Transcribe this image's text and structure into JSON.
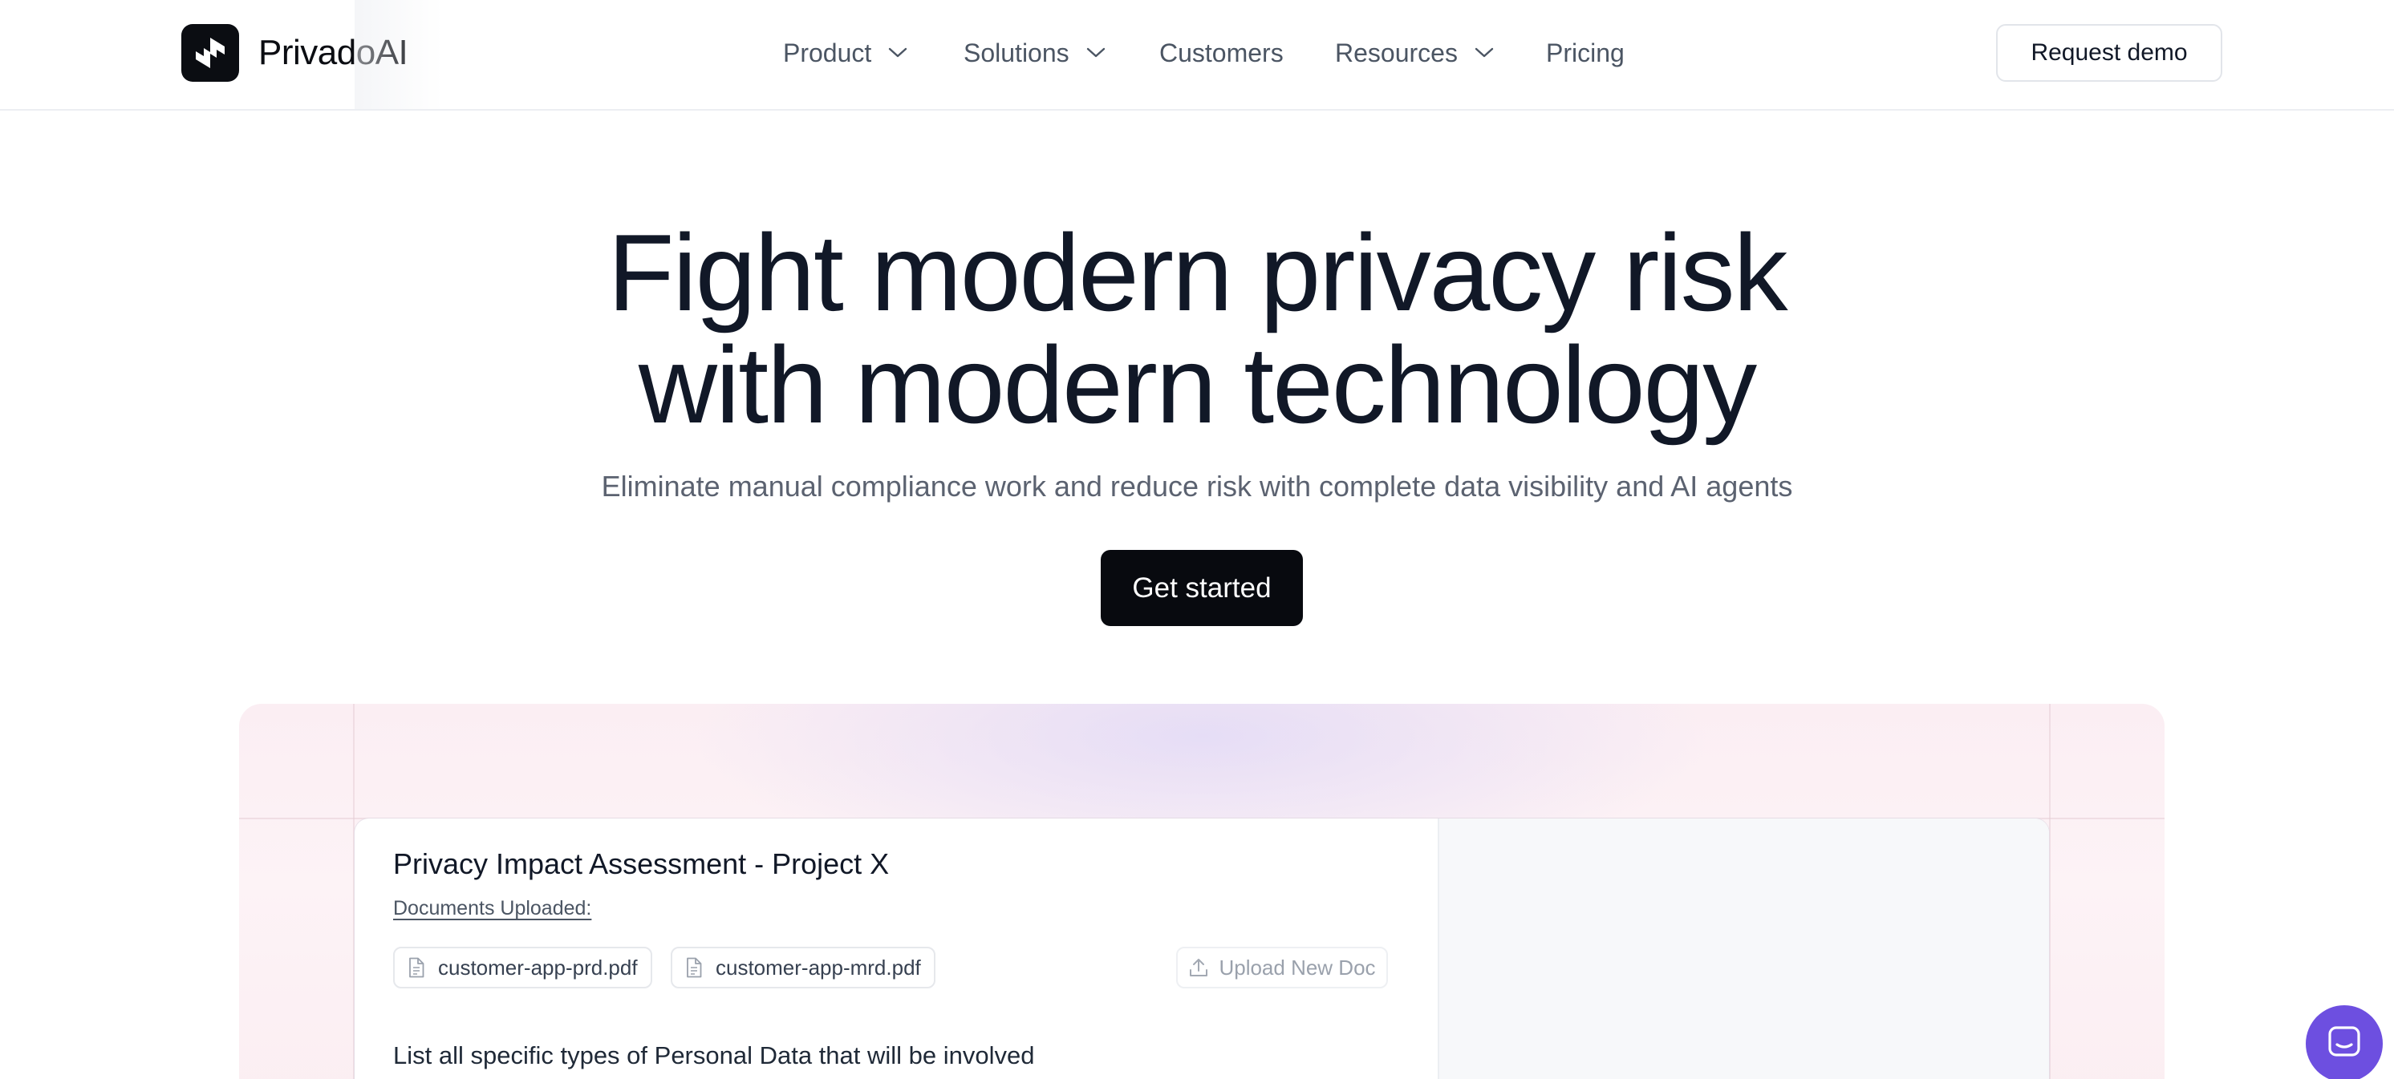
{
  "brand": {
    "name": "PrivadoAI"
  },
  "nav": {
    "items": [
      {
        "label": "Product",
        "has_dropdown": true
      },
      {
        "label": "Solutions",
        "has_dropdown": true
      },
      {
        "label": "Customers",
        "has_dropdown": false
      },
      {
        "label": "Resources",
        "has_dropdown": true
      },
      {
        "label": "Pricing",
        "has_dropdown": false
      }
    ],
    "request_demo_label": "Request demo"
  },
  "hero": {
    "title_line1": "Fight modern privacy risk",
    "title_line2": "with modern technology",
    "subtitle": "Eliminate manual compliance work and reduce risk with complete data visibility and AI agents",
    "cta_label": "Get started"
  },
  "showcase": {
    "title": "Privacy Impact Assessment - Project X",
    "documents_label": "Documents Uploaded:",
    "documents": [
      "customer-app-prd.pdf",
      "customer-app-mrd.pdf"
    ],
    "upload_label": "Upload New Doc",
    "question": "List all specific types of Personal Data that will be involved"
  },
  "icons": {
    "logo": "privado-logo-icon",
    "dropdown": "chevron-down-icon",
    "document": "document-icon",
    "upload": "upload-icon",
    "chat": "chat-icon"
  },
  "colors": {
    "primary_button": "#080a0f",
    "chat_launcher": "#6d4fe0",
    "heading_text": "#111827",
    "muted_text": "#5b6270"
  }
}
